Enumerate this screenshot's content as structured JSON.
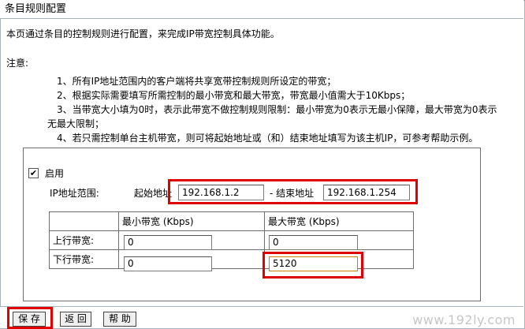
{
  "page": {
    "title": "条目规则配置",
    "intro": "本页通过条目的控制规则进行配置，来完成IP带宽控制具体功能。"
  },
  "notes": {
    "title": "注意:",
    "items": [
      "1、所有IP地址范围内的客户端将共享宽带控制规则所设定的带宽；",
      "2、根据实际需要填写所需控制的最小带宽和最大带宽，带宽最小值需大于10Kbps；",
      "3、当带宽大小填为0时，表示此带宽不做控制规则限制：最小带宽为0表示无最小保障，最大带宽为0表示",
      "无最大限制；",
      "4、若只需控制单台主机带宽，则可将起始地址或（和）结束地址填写为该主机IP，可参考帮助示例。"
    ]
  },
  "form": {
    "enable_label": "启用",
    "enable_checked": true,
    "check_mark": "✔",
    "ip_range_label": "IP地址范围:",
    "start_label": "起始地址",
    "start_value": "192.168.1.2",
    "separator": "-",
    "end_label": "结束地址",
    "end_value": "192.168.1.254"
  },
  "bandwidth_table": {
    "col_min": "最小带宽 (Kbps)",
    "col_max": "最大带宽 (Kbps)",
    "rows": [
      {
        "label": "上行带宽:",
        "min": "0",
        "max": "0"
      },
      {
        "label": "下行带宽:",
        "min": "0",
        "max": "5120"
      }
    ]
  },
  "buttons": {
    "save": "保 存",
    "back": "返 回",
    "help": "帮 助"
  },
  "watermark": "www.192ly.com",
  "colors": {
    "highlight": "#e00000",
    "border": "#a7b4bf",
    "table_border": "#6d6d6d"
  }
}
